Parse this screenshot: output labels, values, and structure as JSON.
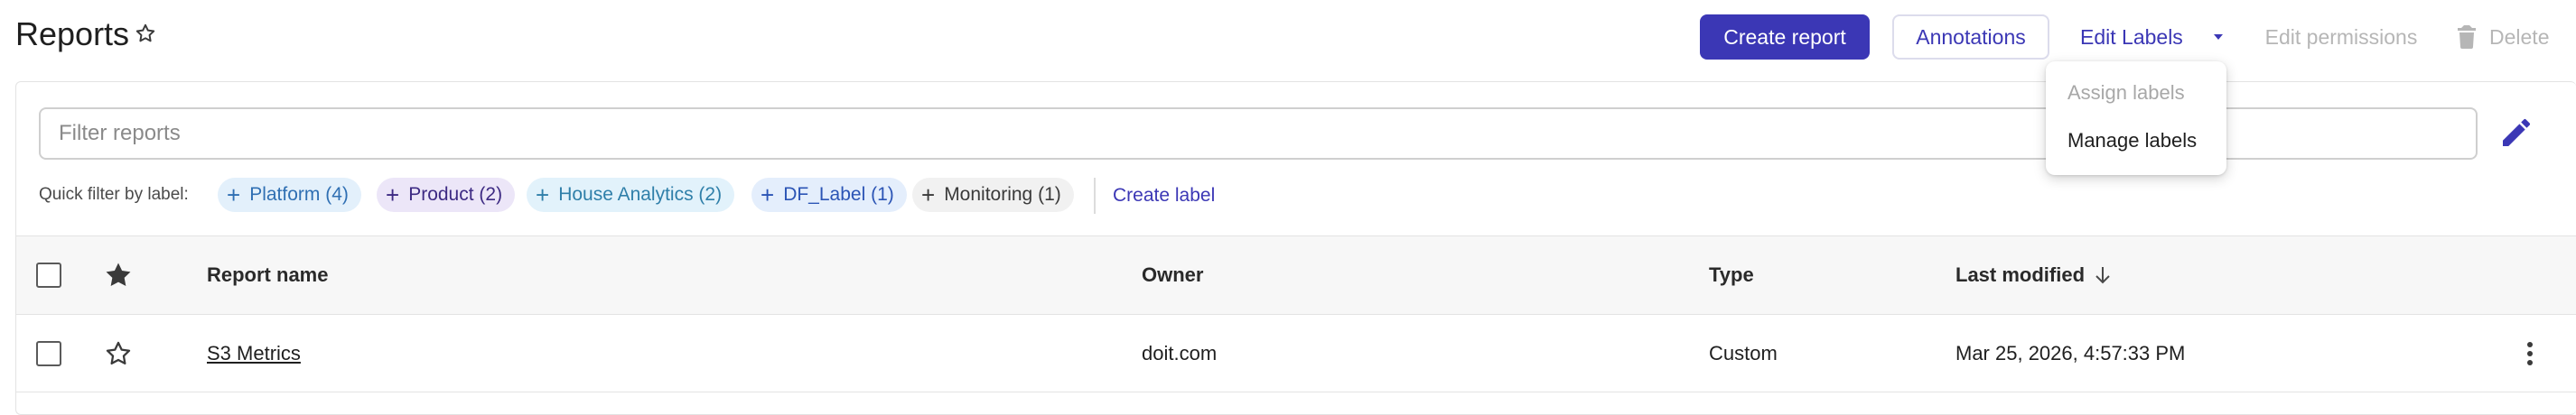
{
  "header": {
    "title": "Reports",
    "create_report": "Create report",
    "annotations": "Annotations",
    "edit_labels": "Edit Labels",
    "edit_permissions": "Edit permissions",
    "delete": "Delete"
  },
  "filter": {
    "placeholder": "Filter reports",
    "value": ""
  },
  "quick_filter": {
    "label": "Quick filter by label:",
    "chips": [
      {
        "label": "Platform (4)"
      },
      {
        "label": "Product (2)"
      },
      {
        "label": "House Analytics (2)"
      },
      {
        "label": "DF_Label (1)"
      },
      {
        "label": "Monitoring (1)"
      }
    ],
    "create_label": "Create label"
  },
  "table": {
    "columns": {
      "name": "Report name",
      "owner": "Owner",
      "type": "Type",
      "last_modified": "Last modified"
    },
    "rows": [
      {
        "name": "S3 Metrics",
        "owner": "doit.com",
        "type": "Custom",
        "last_modified": "Mar 25, 2026, 4:57:33 PM"
      }
    ]
  },
  "dropdown": {
    "items": [
      {
        "label": "Assign labels",
        "disabled": true
      },
      {
        "label": "Manage labels",
        "disabled": false
      }
    ]
  },
  "colors": {
    "primary": "#3b37b5",
    "disabled_text": "#b6b6b6"
  },
  "icons": {
    "title_star": "star-outline-icon",
    "caret": "caret-down-icon",
    "delete": "trash-icon",
    "edit": "pencil-icon",
    "header_star": "star-filled-icon",
    "row_star": "star-outline-icon",
    "sort": "arrow-down-icon",
    "more": "more-vertical-icon"
  }
}
